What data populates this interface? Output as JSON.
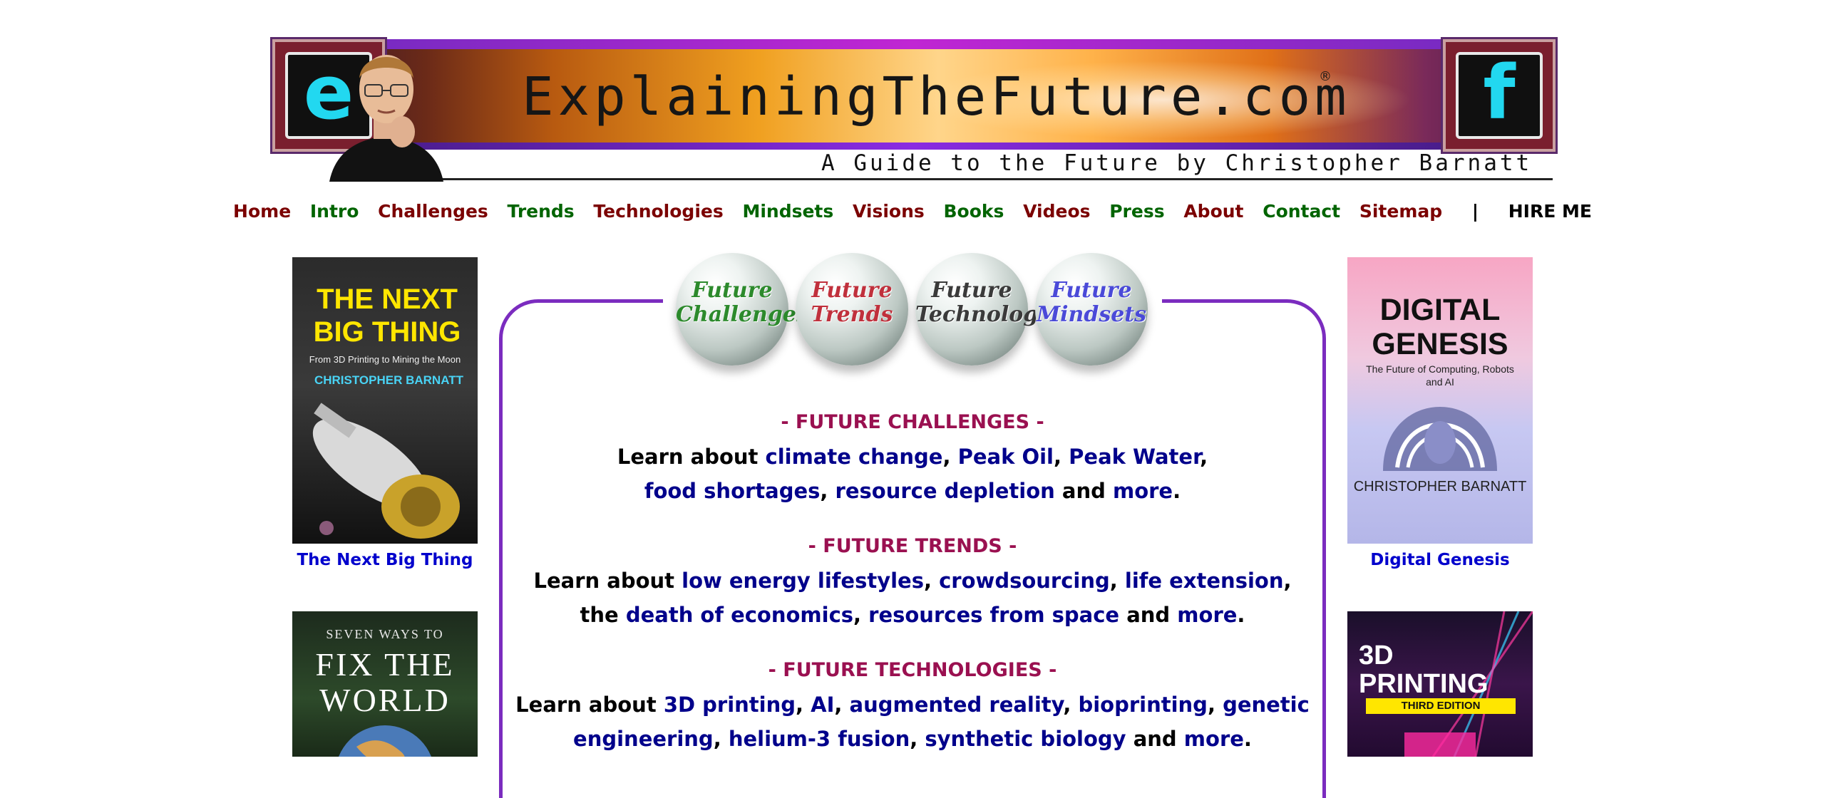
{
  "banner": {
    "title": "ExplainingTheFuture.com",
    "registered": "®",
    "subtitle": "A Guide to the Future by Christopher Barnatt",
    "logo_left_letter": "e",
    "logo_right_letter": "f"
  },
  "nav": {
    "items": [
      {
        "label": "Home",
        "color": "#7b0000"
      },
      {
        "label": "Intro",
        "color": "#006400"
      },
      {
        "label": "Challenges",
        "color": "#7b0000"
      },
      {
        "label": "Trends",
        "color": "#006400"
      },
      {
        "label": "Technologies",
        "color": "#7b0000"
      },
      {
        "label": "Mindsets",
        "color": "#006400"
      },
      {
        "label": "Visions",
        "color": "#7b0000"
      },
      {
        "label": "Books",
        "color": "#006400"
      },
      {
        "label": "Videos",
        "color": "#7b0000"
      },
      {
        "label": "Press",
        "color": "#006400"
      },
      {
        "label": "About",
        "color": "#7b0000"
      },
      {
        "label": "Contact",
        "color": "#006400"
      },
      {
        "label": "Sitemap",
        "color": "#7b0000"
      }
    ],
    "separator": "|",
    "hire": "HIRE ME"
  },
  "left_books": [
    {
      "cover_title": "THE NEXT BIG THING",
      "cover_subtitle": "From 3D Printing to Mining the Moon",
      "cover_author": "CHRISTOPHER BARNATT",
      "caption": "The Next Big Thing"
    },
    {
      "cover_small": "SEVEN WAYS TO",
      "cover_title": "FIX THE WORLD"
    }
  ],
  "right_books": [
    {
      "cover_title": "DIGITAL GENESIS",
      "cover_subtitle": "The Future of Computing, Robots and AI",
      "cover_author": "CHRISTOPHER BARNATT",
      "caption": "Digital Genesis"
    },
    {
      "cover_title": "3D PRINTING",
      "cover_edition": "THIRD EDITION"
    }
  ],
  "spheres": [
    {
      "line1": "Future",
      "line2": "Challenges"
    },
    {
      "line1": "Future",
      "line2": "Trends"
    },
    {
      "line1": "Future",
      "line2": "Technologies"
    },
    {
      "line1": "Future",
      "line2": "Mindsets"
    }
  ],
  "sections": {
    "challenges": {
      "heading": "- FUTURE CHALLENGES -",
      "learn": "Learn about",
      "links": [
        "climate change",
        "Peak Oil",
        "Peak Water",
        "food shortages",
        "resource depletion",
        "more"
      ],
      "and": "and"
    },
    "trends": {
      "heading": "- FUTURE TRENDS -",
      "learn": "Learn about",
      "the": "the",
      "links": [
        "low energy lifestyles",
        "crowdsourcing",
        "life extension",
        "death of economics",
        "resources from space",
        "more"
      ],
      "and": "and"
    },
    "technologies": {
      "heading": "- FUTURE TECHNOLOGIES -",
      "learn": "Learn about",
      "links": [
        "3D printing",
        "AI",
        "augmented reality",
        "bioprinting",
        "genetic",
        "engineering",
        "helium-3 fusion",
        "synthetic biology",
        "more"
      ],
      "and": "and"
    }
  },
  "colors": {
    "nav_red": "#7b0000",
    "nav_green": "#006400",
    "heading_magenta": "#9a1050",
    "link_navy": "#00008b",
    "caption_blue": "#0000cc",
    "panel_purple": "#7b2cbf"
  }
}
